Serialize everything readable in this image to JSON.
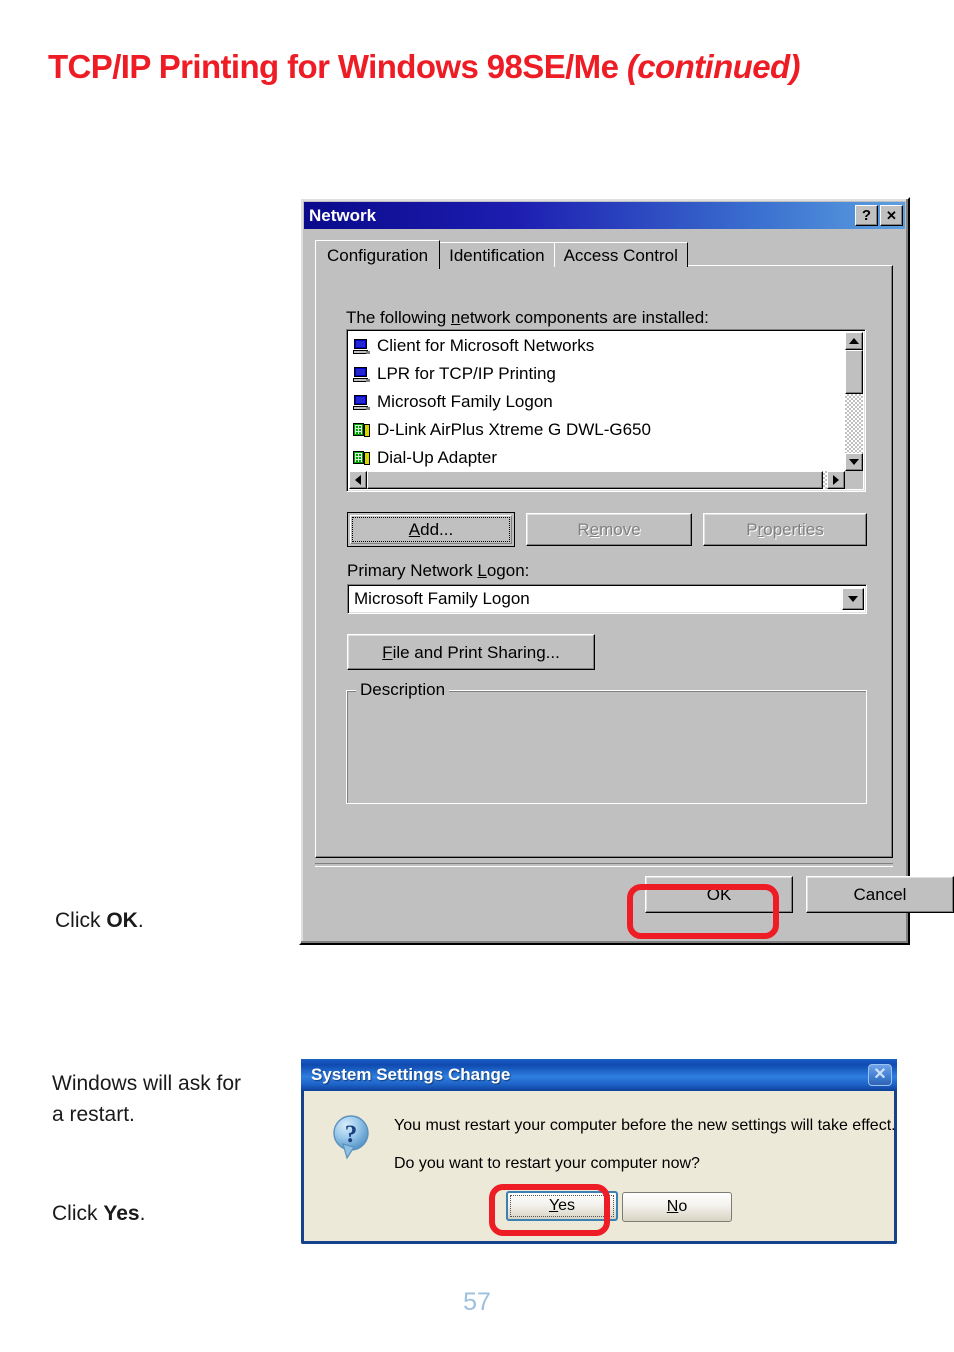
{
  "page": {
    "title_main": "TCP/IP Printing for Windows 98SE/Me",
    "title_continued": "(continued)",
    "number": "57"
  },
  "instructions": {
    "click_ok_prefix": "Click ",
    "click_ok_bold": "OK",
    "click_ok_suffix": ".",
    "restart_note_line1": "Windows will ask for",
    "restart_note_line2": "a restart.",
    "click_yes_prefix": "Click ",
    "click_yes_bold": "Yes",
    "click_yes_suffix": "."
  },
  "network_dialog": {
    "title": "Network",
    "help_button": "?",
    "close_button": "✕",
    "tabs": [
      {
        "label": "Configuration",
        "active": true
      },
      {
        "label": "Identification",
        "active": false
      },
      {
        "label": "Access Control",
        "active": false
      }
    ],
    "components_label_pre": "The following ",
    "components_label_mnemonic": "n",
    "components_label_post": "etwork components are installed:",
    "components": [
      {
        "name": "Client for Microsoft Networks",
        "icon": "computer-icon"
      },
      {
        "name": "LPR for TCP/IP Printing",
        "icon": "computer-icon"
      },
      {
        "name": "Microsoft Family Logon",
        "icon": "computer-icon"
      },
      {
        "name": "D-Link AirPlus Xtreme G DWL-G650",
        "icon": "network-adapter-icon"
      },
      {
        "name": "Dial-Up Adapter",
        "icon": "network-adapter-icon"
      }
    ],
    "buttons": {
      "add_pre": "",
      "add_mnemonic": "A",
      "add_post": "dd...",
      "remove_pre": "R",
      "remove_mnemonic": "e",
      "remove_post": "move",
      "remove_disabled": true,
      "properties_pre": "P",
      "properties_mnemonic": "r",
      "properties_post": "operties",
      "properties_disabled": true,
      "file_print_sharing_mnemonic": "F",
      "file_print_sharing_post": "ile and Print Sharing...",
      "ok": "OK",
      "cancel": "Cancel"
    },
    "primary_logon_label_pre": "Primary Network ",
    "primary_logon_label_mnemonic": "L",
    "primary_logon_label_post": "ogon:",
    "primary_logon_value": "Microsoft Family Logon",
    "description_legend": "Description",
    "description_text": ""
  },
  "restart_dialog": {
    "title": "System Settings Change",
    "close_button": "✕",
    "icon": "question-icon",
    "message_line1": "You must restart your computer before the new settings will take effect.",
    "message_line2": "Do you want to restart your computer now?",
    "yes_mnemonic": "Y",
    "yes_post": "es",
    "no_mnemonic": "N",
    "no_post": "o"
  },
  "colors": {
    "title_red": "#ee1c25",
    "annotation_red": "#ee1c25",
    "page_number_blue": "#9dc0de",
    "win98_face": "#c0c0c0",
    "winxp_face": "#ece9d8",
    "winxp_border_blue": "#15428b"
  }
}
